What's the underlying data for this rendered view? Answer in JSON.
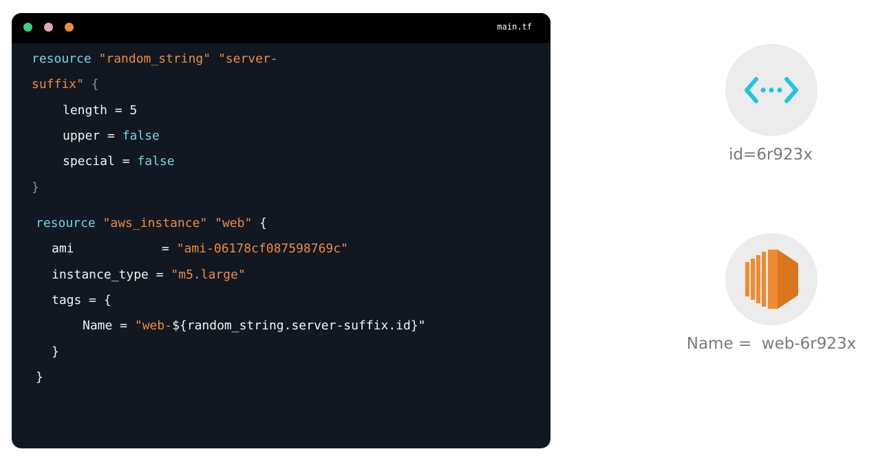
{
  "editor": {
    "filename": "main.tf",
    "code": {
      "l1_kw": "resource",
      "l1_s1": "\"random_string\"",
      "l1_s2": "\"server-",
      "l2_s": "suffix\"",
      "l2_b": "{",
      "l3_a": "length",
      "l3_b": "= 5",
      "l4_a": "upper =",
      "l4_b": "false",
      "l5_a": "special =",
      "l5_b": "false",
      "l6": "}",
      "l7_kw": "resource",
      "l7_s1": "\"aws_instance\"",
      "l7_s2": "\"web\"",
      "l7_b": "{",
      "l8_a": "ami",
      "l8_b": "=",
      "l8_s": "\"ami-06178cf087598769c\"",
      "l9_a": "instance_type =",
      "l9_s": "\"m5.large\"",
      "l10": "tags = {",
      "l11_a": "Name =",
      "l11_s": "\"web-",
      "l11_c": "${random_string.server-suffix.id}\"",
      "l12": "}",
      "l13": "}"
    }
  },
  "resources": [
    {
      "icon": "random-string-icon",
      "label": "id=6r923x",
      "color": "#1fc4e6"
    },
    {
      "icon": "ec2-instance-icon",
      "label": "Name =  web-6r923x",
      "color": "#ef8a2e"
    }
  ]
}
